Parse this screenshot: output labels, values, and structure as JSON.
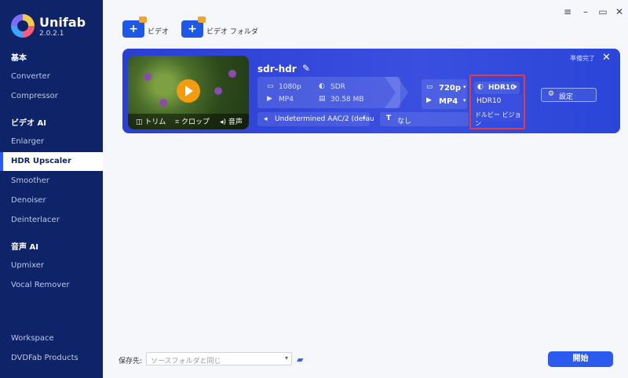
{
  "app": {
    "brand": "Unifab",
    "version": "2.0.2.1"
  },
  "window_controls": [
    "≡",
    "–",
    "▭",
    "✕"
  ],
  "sidebar": {
    "sections": [
      {
        "label": "基本",
        "items": [
          "Converter",
          "Compressor"
        ]
      },
      {
        "label": "ビデオ AI",
        "items": [
          "Enlarger",
          "HDR Upscaler",
          "Smoother",
          "Denoiser",
          "Deinterlacer"
        ]
      },
      {
        "label": "音声 AI",
        "items": [
          "Upmixer",
          "Vocal Remover"
        ]
      }
    ],
    "bottom": [
      "Workspace",
      "DVDFab Products"
    ],
    "active": "HDR Upscaler"
  },
  "toolbar": {
    "add_video_label": "ビデオ",
    "add_folder_label": "ビデオ フォルダ",
    "plus": "+"
  },
  "task": {
    "title": "sdr-hdr",
    "status": "準備完了",
    "close": "✕",
    "thumb": {
      "trim": "トリム",
      "crop": "クロップ",
      "audio": "音声"
    },
    "source": {
      "resolution": "1080p",
      "hdr": "SDR",
      "format": "MP4",
      "size": "30.58 MB"
    },
    "audio_track": "Undetermined AAC/2 (defau",
    "subtitle": "なし",
    "output": {
      "resolution": "720p",
      "format": "MP4"
    },
    "hdr_select": "HDR10",
    "hdr_options": [
      "HDR10",
      "ドルビー ビジョン"
    ],
    "settings_label": "設定"
  },
  "footer": {
    "save_label": "保存先:",
    "save_value": "ソースフォルダと同じ",
    "start_label": "開始"
  },
  "colors": {
    "sidebar_bg": "#0f2468",
    "accent": "#2a5af0",
    "highlight": "#e83b3b"
  }
}
